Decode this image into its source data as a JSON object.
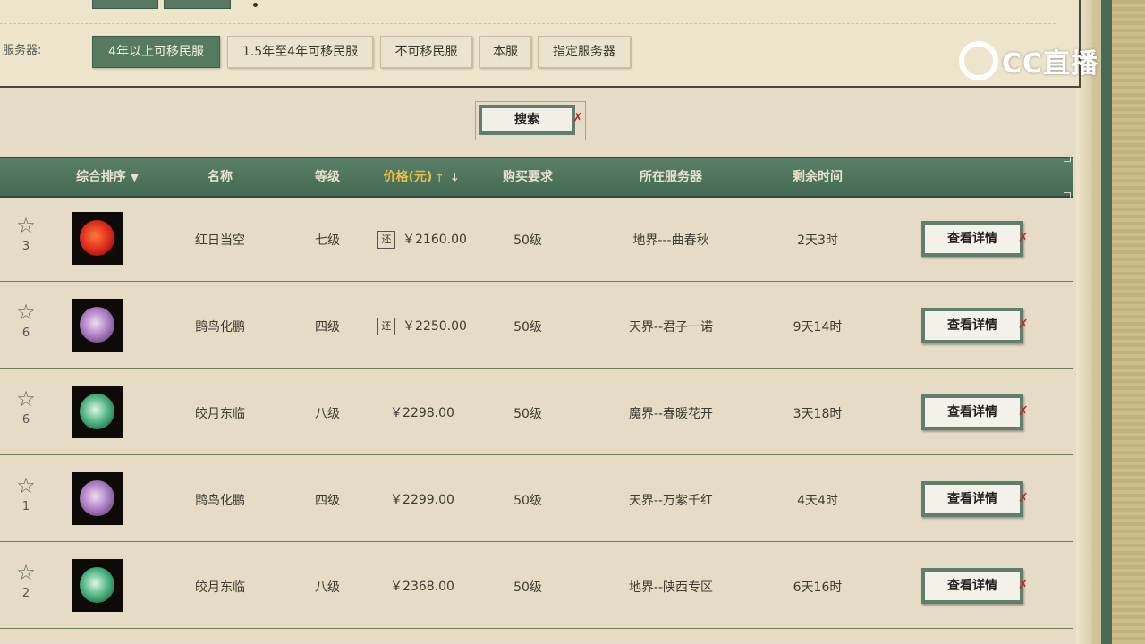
{
  "filters": {
    "server_label": "服务器:",
    "server_options": [
      {
        "label": "4年以上可移民服",
        "active": true
      },
      {
        "label": "1.5年至4年可移民服",
        "active": false
      },
      {
        "label": "不可移民服",
        "active": false
      },
      {
        "label": "本服",
        "active": false
      },
      {
        "label": "指定服务器",
        "active": false
      }
    ]
  },
  "search": {
    "label": "搜索"
  },
  "table": {
    "headers": {
      "sort": "综合排序",
      "name": "名称",
      "level": "等级",
      "price": "价格(元)",
      "requirement": "购买要求",
      "server": "所在服务器",
      "time": "剩余时间"
    },
    "rows": [
      {
        "count": "3",
        "image": "red-orb-icon",
        "name": "红日当空",
        "level": "七级",
        "returnable": "还",
        "price": "￥2160.00",
        "requirement": "50级",
        "server": "地界---曲春秋",
        "time": "2天3时",
        "action": "查看详情"
      },
      {
        "count": "6",
        "image": "purple-orb-icon",
        "name": "鹍鸟化鹏",
        "level": "四级",
        "returnable": "还",
        "price": "￥2250.00",
        "requirement": "50级",
        "server": "天界--君子一诺",
        "time": "9天14时",
        "action": "查看详情"
      },
      {
        "count": "6",
        "image": "green-orb-icon",
        "name": "皎月东临",
        "level": "八级",
        "returnable": "",
        "price": "￥2298.00",
        "requirement": "50级",
        "server": "魔界--春暖花开",
        "time": "3天18时",
        "action": "查看详情"
      },
      {
        "count": "1",
        "image": "purple-orb-icon",
        "name": "鹍鸟化鹏",
        "level": "四级",
        "returnable": "",
        "price": "￥2299.00",
        "requirement": "50级",
        "server": "天界--万紫千红",
        "time": "4天4时",
        "action": "查看详情"
      },
      {
        "count": "2",
        "image": "green-orb-icon",
        "name": "皎月东临",
        "level": "八级",
        "returnable": "",
        "price": "￥2368.00",
        "requirement": "50级",
        "server": "地界--陕西专区",
        "time": "6天16时",
        "action": "查看详情"
      }
    ]
  },
  "watermark": {
    "text": "CC直播"
  }
}
